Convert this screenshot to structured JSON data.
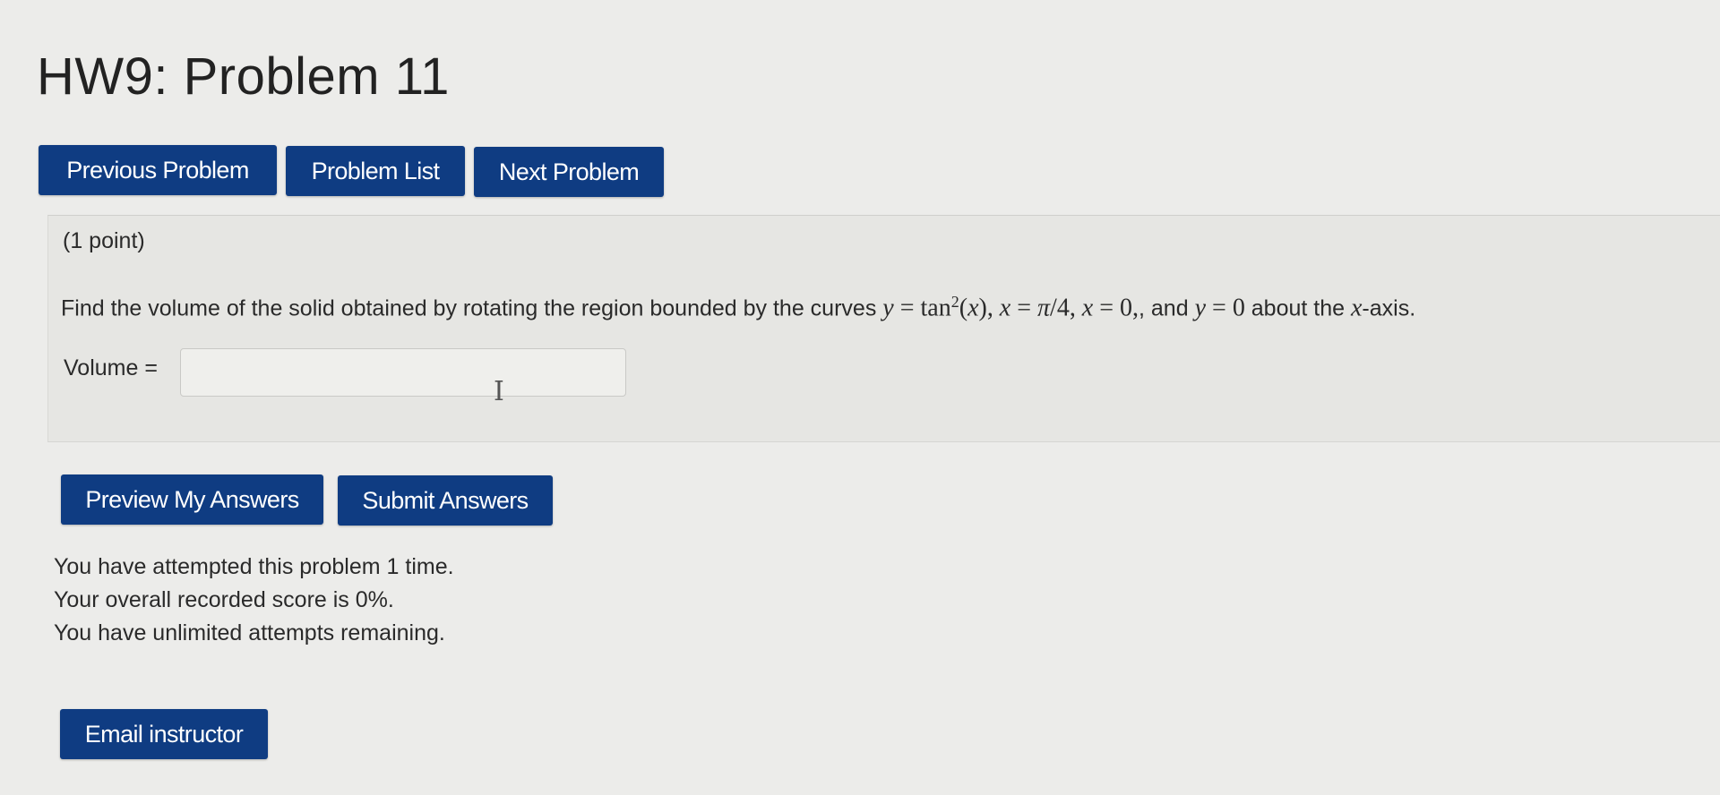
{
  "page": {
    "title": "HW9: Problem 11"
  },
  "nav": {
    "previous_label": "Previous Problem",
    "list_label": "Problem List",
    "next_label": "Next Problem"
  },
  "problem": {
    "points": "(1 point)",
    "statement_intro": "Find the volume of the solid obtained by rotating the region bounded by the curves",
    "statement_and": ", and",
    "statement_about": "about the",
    "statement_axis_suffix": "-axis.",
    "math": {
      "y": "y",
      "eq": " = ",
      "tan": "tan",
      "exp": "2",
      "x_arg_open": "(",
      "x": "x",
      "x_arg_close": "),",
      "pi": "π",
      "div4": "/4,",
      "zero_comma": "0,",
      "zero": "0"
    },
    "answer_label": "Volume =",
    "answer_value": "",
    "answer_placeholder": ""
  },
  "actions": {
    "preview_label": "Preview My Answers",
    "submit_label": "Submit Answers",
    "email_label": "Email instructor"
  },
  "status": {
    "attempts": "You have attempted this problem 1 time.",
    "score": "Your overall recorded score is 0%.",
    "remaining": "You have unlimited attempts remaining."
  },
  "colors": {
    "button_bg": "#0f3c82",
    "button_text": "#ffffff",
    "page_bg": "#ececea",
    "problem_bg": "#e6e6e3"
  },
  "icons": {
    "text_cursor": "i-beam-cursor-icon"
  }
}
